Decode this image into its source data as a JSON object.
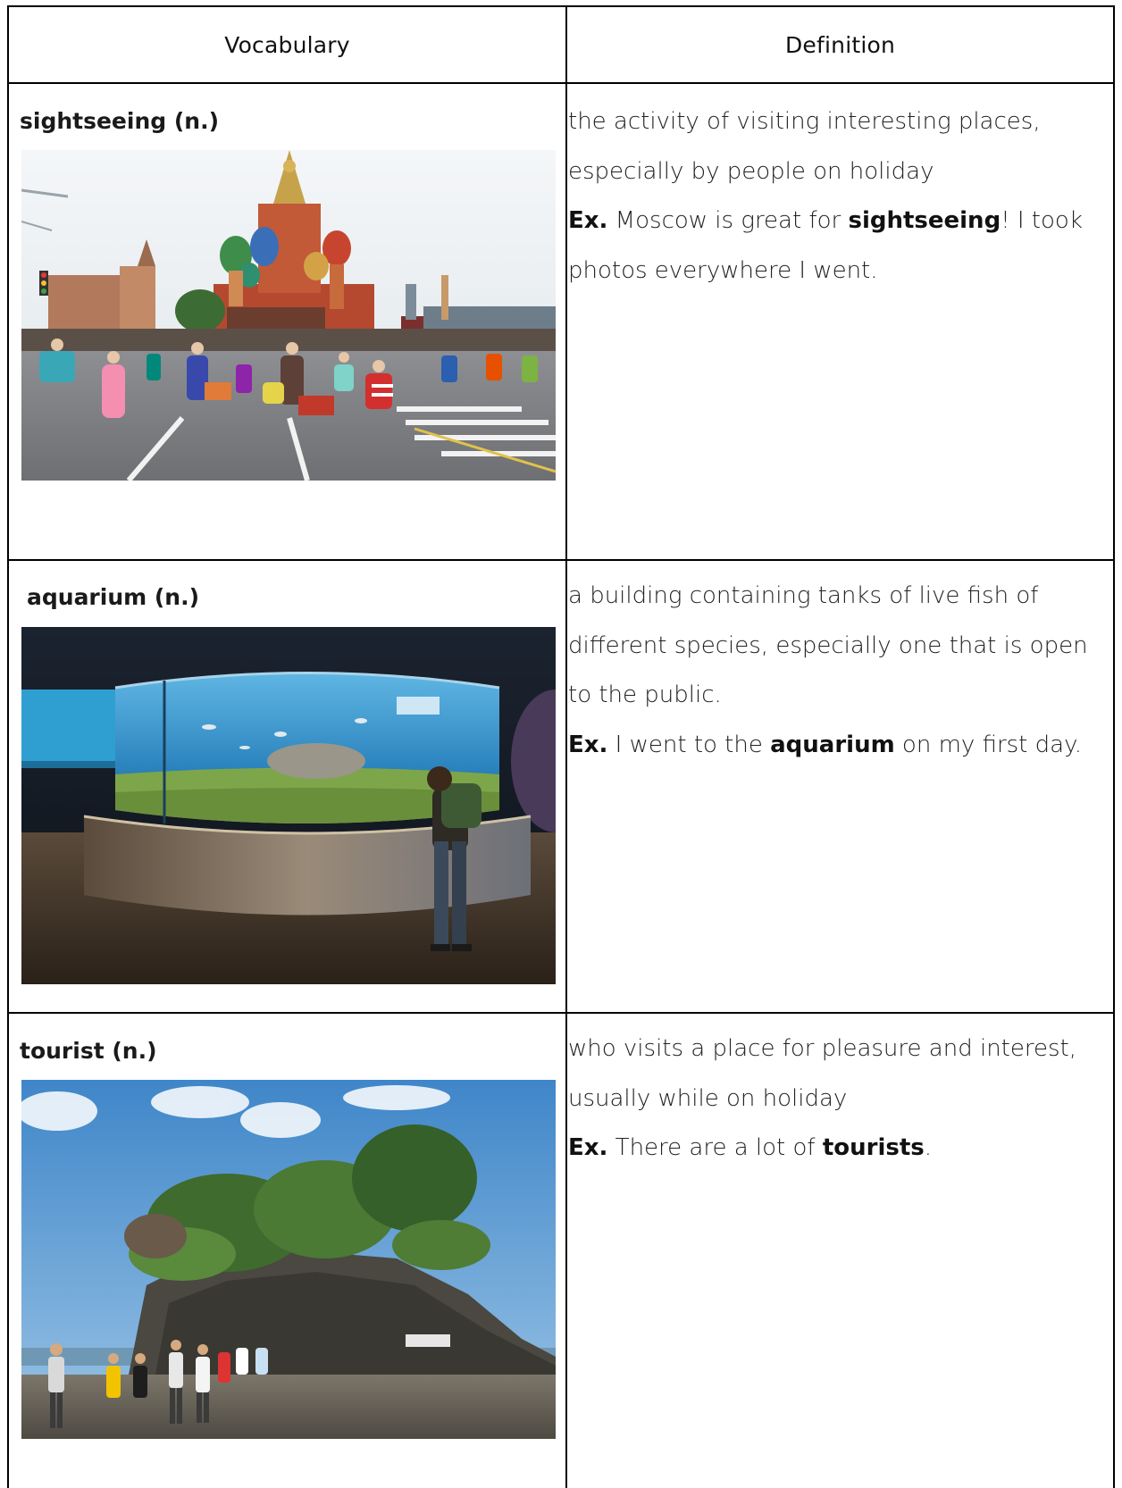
{
  "header": {
    "col_vocabulary": "Vocabulary",
    "col_definition": "Definition"
  },
  "rows": [
    {
      "term": "sightseeing (n.)",
      "definition": "the activity of visiting interesting places, especially by people on holiday",
      "example_prefix": "Ex.",
      "example_before": " Moscow is great for ",
      "example_keyword": "sightseeing",
      "example_after": "! I took photos everywhere I went.",
      "image_icon": "red-square-moscow-photo"
    },
    {
      "term": "aquarium (n.)",
      "definition": "a building containing tanks of live fish of different species, especially one that is open to the public.",
      "example_prefix": "Ex.",
      "example_before": " I went to the ",
      "example_keyword": "aquarium",
      "example_after": " on my first day.",
      "image_icon": "aquarium-tank-photo"
    },
    {
      "term": "tourist (n.)",
      "definition": "who visits a place for pleasure and interest, usually while on holiday",
      "example_prefix": "Ex.",
      "example_before": " There are a lot of ",
      "example_keyword": "tourists",
      "example_after": ".",
      "image_icon": "sea-temple-tourists-photo"
    }
  ]
}
